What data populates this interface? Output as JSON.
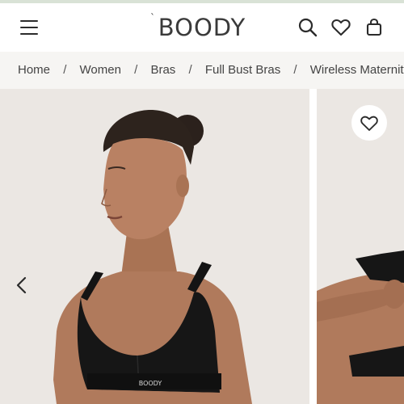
{
  "header": {
    "brand": "BOODY",
    "icons": [
      "menu-icon",
      "search-icon",
      "heart-icon",
      "bag-icon"
    ]
  },
  "breadcrumb": {
    "items": [
      "Home",
      "Women",
      "Bras",
      "Full Bust Bras",
      "Wireless Maternity Bra"
    ],
    "separator": "/"
  },
  "gallery": {
    "band_logo": "BOODY",
    "controls": [
      "chevron-left-icon",
      "heart-icon"
    ]
  },
  "colors": {
    "accent_line": "#d9e2d6",
    "breadcrumb_bg": "#f6f5f3",
    "photo_bg": "#ebe7e3",
    "text": "#2b2b2b"
  }
}
